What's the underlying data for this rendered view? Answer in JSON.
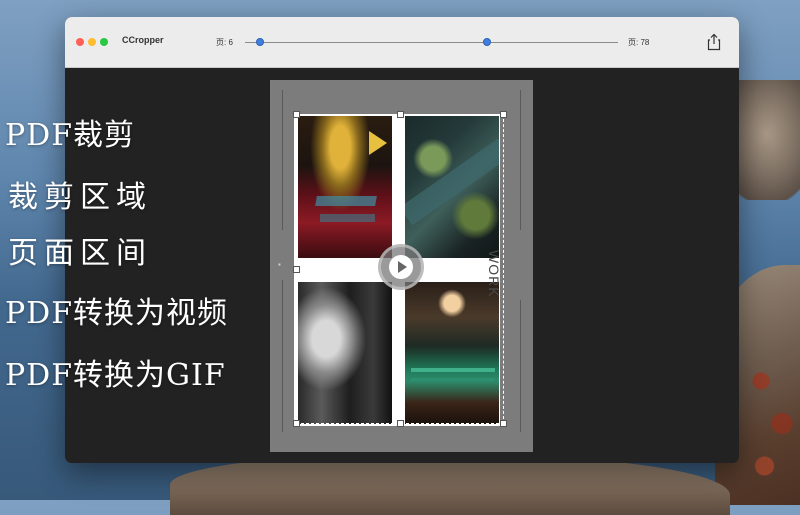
{
  "window": {
    "title": "CCropper"
  },
  "toolbar": {
    "page_start_label": "页: 6",
    "page_end_label": "页: 78",
    "range_start_fraction": 0.04,
    "range_end_fraction": 0.65,
    "share_icon": "share-icon"
  },
  "document": {
    "side_text": "WORK"
  },
  "promo": {
    "items": [
      "PDF裁剪",
      "裁剪区域",
      "页面区间",
      "PDF转换为视频",
      "PDF转换为GIF"
    ]
  },
  "colors": {
    "accent": "#3f7fe0",
    "window_bg": "#222222",
    "page_bg": "#7c7c7c",
    "titlebar_bg": "#ececec"
  }
}
